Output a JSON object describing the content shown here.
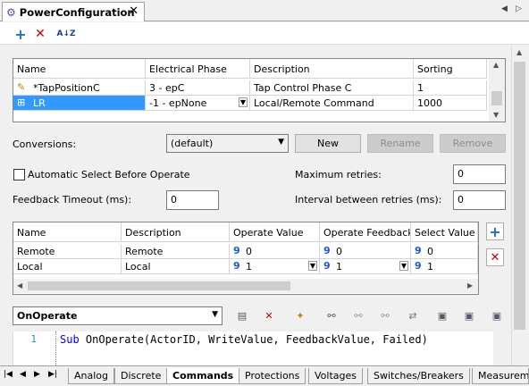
{
  "window": {
    "tab_title": "PowerConfiguration",
    "close_glyph": "✕"
  },
  "toolbar": {
    "add": "+",
    "delete": "✕",
    "sort": "A↓Z"
  },
  "top_table": {
    "columns": [
      "Name",
      "Electrical Phase",
      "Description",
      "Sorting"
    ],
    "rows": [
      {
        "name": "*TapPositionC",
        "phase": "3 - epC",
        "description": "Tap Control Phase C",
        "sorting": "1"
      },
      {
        "name": "LR",
        "phase": "-1 - epNone",
        "description": "Local/Remote Command",
        "sorting": "1000"
      }
    ]
  },
  "conversions": {
    "label": "Conversions:",
    "value": "(default)",
    "new_label": "New",
    "rename_label": "Rename",
    "remove_label": "Remove"
  },
  "settings": {
    "auto_select_label": "Automatic Select Before Operate",
    "max_retries_label": "Maximum retries:",
    "max_retries_value": "0",
    "feedback_timeout_label": "Feedback Timeout (ms):",
    "feedback_timeout_value": "0",
    "retry_interval_label": "Interval between retries (ms):",
    "retry_interval_value": "0"
  },
  "conv_table": {
    "columns": [
      "Name",
      "Description",
      "Operate Value",
      "Operate Feedback",
      "Select Value"
    ],
    "rows": [
      {
        "name": "Remote",
        "description": "Remote",
        "operate_value": "0",
        "operate_feedback": "0",
        "select_value": "0"
      },
      {
        "name": "Local",
        "description": "Local",
        "operate_value": "1",
        "operate_feedback": "1",
        "select_value": "1"
      }
    ],
    "add": "+",
    "delete": "✕"
  },
  "script": {
    "event": "OnOperate",
    "line_number": "1",
    "keyword": "Sub",
    "line_text": " OnOperate(ActorID, WriteValue, FeedbackValue, Failed)"
  },
  "bottom_tabs": [
    "Analog",
    "Discrete",
    "Commands",
    "Protections",
    "Voltages",
    "Switches/Breakers",
    "Measureme"
  ],
  "active_bottom_tab": "Commands",
  "colors": {
    "accent": "#3399ff",
    "add_icon": "#1e73be",
    "delete_icon": "#c00000"
  }
}
